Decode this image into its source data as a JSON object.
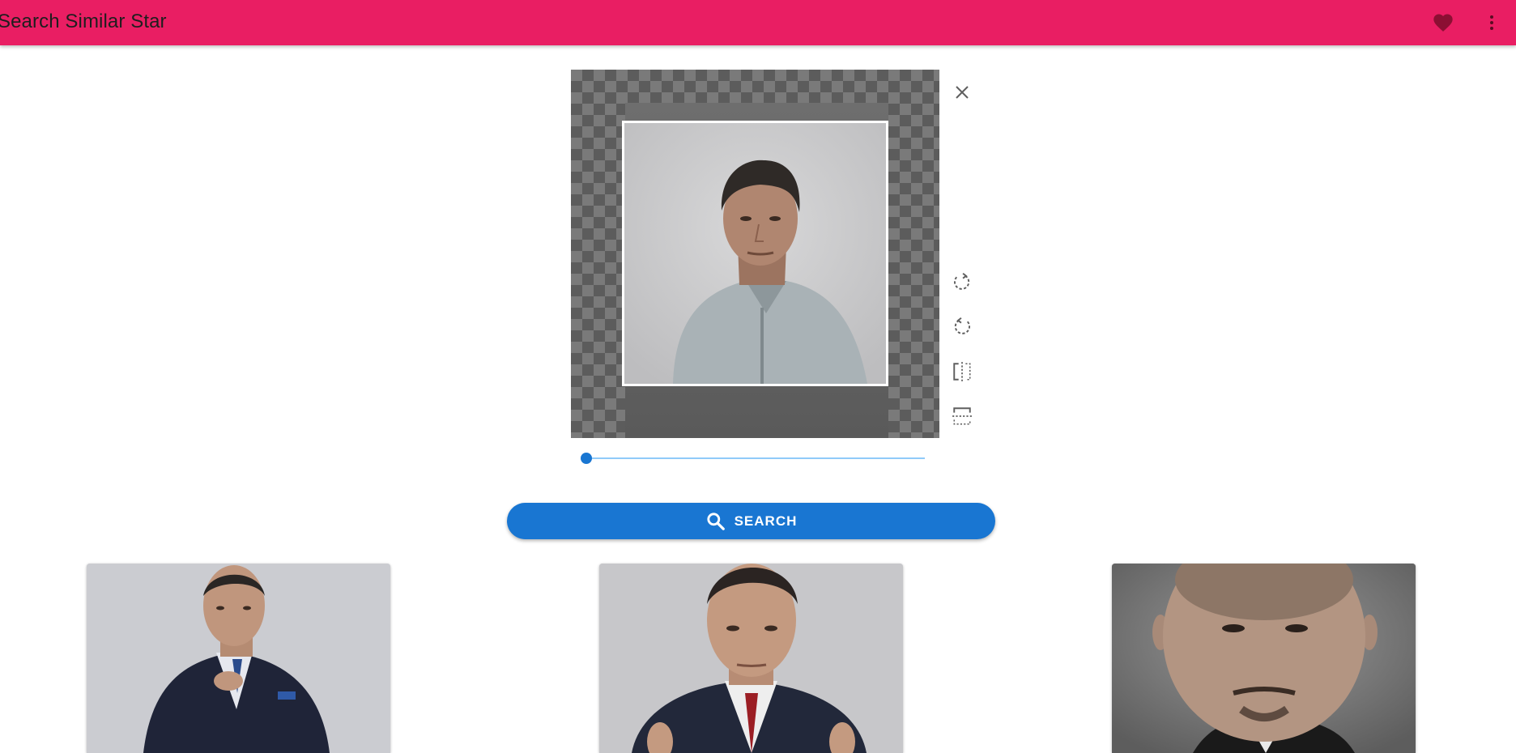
{
  "app": {
    "title": "Search Similar Star",
    "bar_color": "#e91e63",
    "actions": [
      "heart-icon",
      "more-vert-icon"
    ]
  },
  "cropper": {
    "tools": [
      "close-icon",
      "rotate-right-icon",
      "rotate-left-icon",
      "flip-horizontal-icon",
      "flip-vertical-icon"
    ],
    "zoom_fraction": 0
  },
  "search": {
    "label": "SEARCH",
    "icon": "search-icon",
    "color": "#1976d2"
  },
  "results": [
    {
      "icon": "person-photo"
    },
    {
      "icon": "person-photo"
    },
    {
      "icon": "person-photo"
    }
  ]
}
